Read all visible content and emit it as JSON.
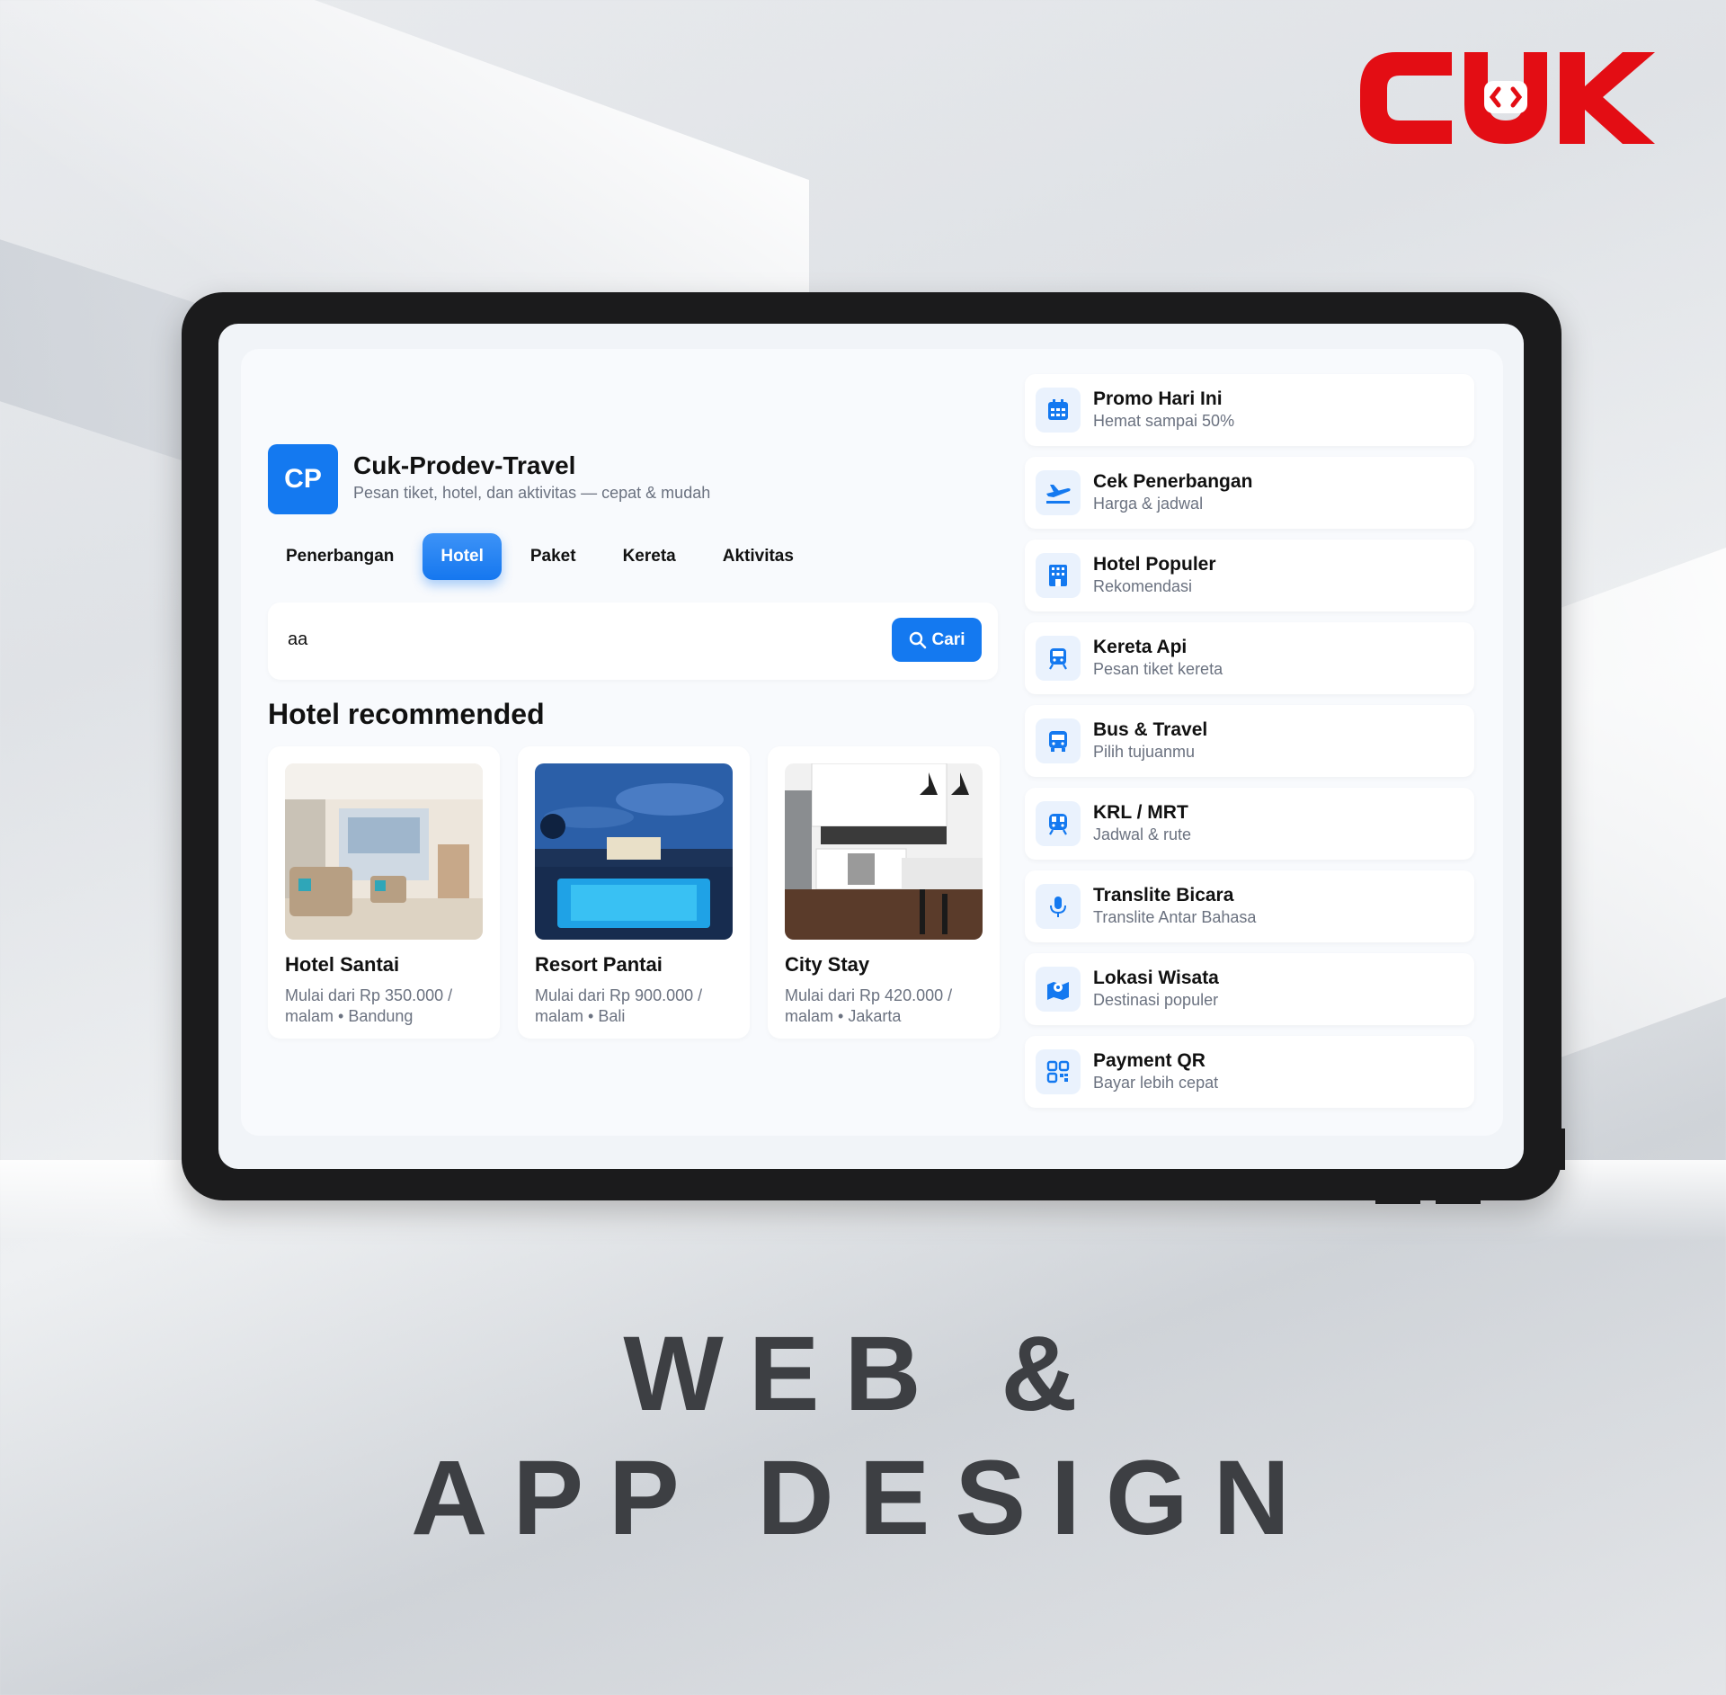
{
  "logo_text": "CUK",
  "app": {
    "badge": "CP",
    "title": "Cuk-Prodev-Travel",
    "subtitle": "Pesan tiket, hotel, dan aktivitas — cepat & mudah"
  },
  "tabs": [
    {
      "label": "Penerbangan",
      "active": false
    },
    {
      "label": "Hotel",
      "active": true
    },
    {
      "label": "Paket",
      "active": false
    },
    {
      "label": "Kereta",
      "active": false
    },
    {
      "label": "Aktivitas",
      "active": false
    }
  ],
  "search": {
    "value": "aa",
    "button_label": "Cari"
  },
  "section_title": "Hotel recommended",
  "hotels": [
    {
      "name": "Hotel Santai",
      "desc": "Mulai dari Rp 350.000 / malam • Bandung"
    },
    {
      "name": "Resort Pantai",
      "desc": "Mulai dari Rp 900.000 / malam • Bali"
    },
    {
      "name": "City Stay",
      "desc": "Mulai dari Rp 420.000 / malam • Jakarta"
    }
  ],
  "side_items": [
    {
      "title": "Promo Hari Ini",
      "sub": "Hemat sampai 50%",
      "icon": "calendar-icon"
    },
    {
      "title": "Cek Penerbangan",
      "sub": "Harga & jadwal",
      "icon": "plane-icon"
    },
    {
      "title": "Hotel Populer",
      "sub": "Rekomendasi",
      "icon": "building-icon"
    },
    {
      "title": "Kereta Api",
      "sub": "Pesan tiket kereta",
      "icon": "train-icon"
    },
    {
      "title": "Bus & Travel",
      "sub": "Pilih tujuanmu",
      "icon": "bus-icon"
    },
    {
      "title": "KRL / MRT",
      "sub": "Jadwal & rute",
      "icon": "subway-icon"
    },
    {
      "title": "Translite Bicara",
      "sub": "Translite Antar Bahasa",
      "icon": "microphone-icon"
    },
    {
      "title": "Lokasi Wisata",
      "sub": "Destinasi populer",
      "icon": "map-icon"
    },
    {
      "title": "Payment QR",
      "sub": "Bayar lebih cepat",
      "icon": "qr-code-icon"
    }
  ],
  "headline": {
    "line1": "WEB &",
    "line2": "APP DESIGN"
  },
  "colors": {
    "accent": "#1479f0",
    "logo_red": "#e30d14",
    "headline": "#3d3f43"
  }
}
